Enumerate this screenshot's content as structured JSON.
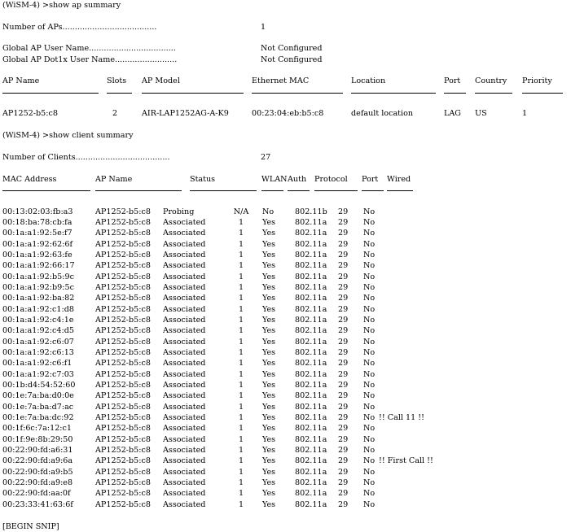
{
  "ap_cmd": {
    "prompt": "(WiSM-4) >show ap summary",
    "num_aps_label": "Number of APs......................................",
    "num_aps_value": "1",
    "user_name_label": "Global AP User Name...................................",
    "user_name_value": "Not Configured",
    "dot1x_label": "Global AP Dot1x User Name.........................",
    "dot1x_value": "Not Configured",
    "headers": [
      "AP Name",
      "Slots",
      "AP Model",
      "Ethernet MAC",
      "Location",
      "Port",
      "Country",
      "Priority"
    ],
    "row": [
      "AP1252-b5:c8",
      "2",
      "AIR-LAP1252AG-A-K9",
      "00:23:04:eb:b5:c8",
      "default location",
      "LAG",
      "US",
      "1"
    ]
  },
  "client_cmd": {
    "prompt": "(WiSM-4) >show client summary",
    "num_clients_label": "Number of Clients......................................",
    "num_clients_value": "27",
    "headers": [
      "MAC Address",
      "AP Name",
      "Status",
      "WLAN",
      "Auth",
      "Protocol",
      "Port",
      "Wired"
    ],
    "clients": [
      {
        "mac": "00:13:02:03:fb:a3",
        "ap": "AP1252-b5:c8",
        "status": "Probing",
        "wlan": "N/A",
        "auth": "No",
        "protocol": "802.11b",
        "port": "29",
        "wired": "No",
        "note": ""
      },
      {
        "mac": "00:18:ba:78:cb:fa",
        "ap": "AP1252-b5:c8",
        "status": "Associated",
        "wlan": "1",
        "auth": "Yes",
        "protocol": "802.11a",
        "port": "29",
        "wired": "No",
        "note": ""
      },
      {
        "mac": "00:1a:a1:92:5e:f7",
        "ap": "AP1252-b5:c8",
        "status": "Associated",
        "wlan": "1",
        "auth": "Yes",
        "protocol": "802.11a",
        "port": "29",
        "wired": "No",
        "note": ""
      },
      {
        "mac": "00:1a:a1:92:62:6f",
        "ap": "AP1252-b5:c8",
        "status": "Associated",
        "wlan": "1",
        "auth": "Yes",
        "protocol": "802.11a",
        "port": "29",
        "wired": "No",
        "note": ""
      },
      {
        "mac": "00:1a:a1:92:63:fe",
        "ap": "AP1252-b5:c8",
        "status": "Associated",
        "wlan": "1",
        "auth": "Yes",
        "protocol": "802.11a",
        "port": "29",
        "wired": "No",
        "note": ""
      },
      {
        "mac": "00:1a:a1:92:66:17",
        "ap": "AP1252-b5:c8",
        "status": "Associated",
        "wlan": "1",
        "auth": "Yes",
        "protocol": "802.11a",
        "port": "29",
        "wired": "No",
        "note": ""
      },
      {
        "mac": "00:1a:a1:92:b5:9c",
        "ap": "AP1252-b5:c8",
        "status": "Associated",
        "wlan": "1",
        "auth": "Yes",
        "protocol": "802.11a",
        "port": "29",
        "wired": "No",
        "note": ""
      },
      {
        "mac": "00:1a:a1:92:b9:5c",
        "ap": "AP1252-b5:c8",
        "status": "Associated",
        "wlan": "1",
        "auth": "Yes",
        "protocol": "802.11a",
        "port": "29",
        "wired": "No",
        "note": ""
      },
      {
        "mac": "00:1a:a1:92:ba:82",
        "ap": "AP1252-b5:c8",
        "status": "Associated",
        "wlan": "1",
        "auth": "Yes",
        "protocol": "802.11a",
        "port": "29",
        "wired": "No",
        "note": ""
      },
      {
        "mac": "00:1a:a1:92:c1:d8",
        "ap": "AP1252-b5:c8",
        "status": "Associated",
        "wlan": "1",
        "auth": "Yes",
        "protocol": "802.11a",
        "port": "29",
        "wired": "No",
        "note": ""
      },
      {
        "mac": "00:1a:a1:92:c4:1e",
        "ap": "AP1252-b5:c8",
        "status": "Associated",
        "wlan": "1",
        "auth": "Yes",
        "protocol": "802.11a",
        "port": "29",
        "wired": "No",
        "note": ""
      },
      {
        "mac": "00:1a:a1:92:c4:d5",
        "ap": "AP1252-b5:c8",
        "status": "Associated",
        "wlan": "1",
        "auth": "Yes",
        "protocol": "802.11a",
        "port": "29",
        "wired": "No",
        "note": ""
      },
      {
        "mac": "00:1a:a1:92:c6:07",
        "ap": "AP1252-b5:c8",
        "status": "Associated",
        "wlan": "1",
        "auth": "Yes",
        "protocol": "802.11a",
        "port": "29",
        "wired": "No",
        "note": ""
      },
      {
        "mac": "00:1a:a1:92:c6:13",
        "ap": "AP1252-b5:c8",
        "status": "Associated",
        "wlan": "1",
        "auth": "Yes",
        "protocol": "802.11a",
        "port": "29",
        "wired": "No",
        "note": ""
      },
      {
        "mac": "00:1a:a1:92:c6:f1",
        "ap": "AP1252-b5:c8",
        "status": "Associated",
        "wlan": "1",
        "auth": "Yes",
        "protocol": "802.11a",
        "port": "29",
        "wired": "No",
        "note": ""
      },
      {
        "mac": "00:1a:a1:92:c7:03",
        "ap": "AP1252-b5:c8",
        "status": "Associated",
        "wlan": "1",
        "auth": "Yes",
        "protocol": "802.11a",
        "port": "29",
        "wired": "No",
        "note": ""
      },
      {
        "mac": "00:1b:d4:54:52:60",
        "ap": "AP1252-b5:c8",
        "status": "Associated",
        "wlan": "1",
        "auth": "Yes",
        "protocol": "802.11a",
        "port": "29",
        "wired": "No",
        "note": ""
      },
      {
        "mac": "00:1e:7a:ba:d0:0e",
        "ap": "AP1252-b5:c8",
        "status": "Associated",
        "wlan": "1",
        "auth": "Yes",
        "protocol": "802.11a",
        "port": "29",
        "wired": "No",
        "note": ""
      },
      {
        "mac": "00:1e:7a:ba:d7:ac",
        "ap": "AP1252-b5:c8",
        "status": "Associated",
        "wlan": "1",
        "auth": "Yes",
        "protocol": "802.11a",
        "port": "29",
        "wired": "No",
        "note": ""
      },
      {
        "mac": "00:1e:7a:ba:dc:92",
        "ap": "AP1252-b5:c8",
        "status": "Associated",
        "wlan": "1",
        "auth": "Yes",
        "protocol": "802.11a",
        "port": "29",
        "wired": "No",
        "note": "!! Call 11 !!"
      },
      {
        "mac": "00:1f:6c:7a:12:c1",
        "ap": "AP1252-b5:c8",
        "status": "Associated",
        "wlan": "1",
        "auth": "Yes",
        "protocol": "802.11a",
        "port": "29",
        "wired": "No",
        "note": ""
      },
      {
        "mac": "00:1f:9e:8b:29:50",
        "ap": "AP1252-b5:c8",
        "status": "Associated",
        "wlan": "1",
        "auth": "Yes",
        "protocol": "802.11a",
        "port": "29",
        "wired": "No",
        "note": ""
      },
      {
        "mac": "00:22:90:fd:a6:31",
        "ap": "AP1252-b5:c8",
        "status": "Associated",
        "wlan": "1",
        "auth": "Yes",
        "protocol": "802.11a",
        "port": "29",
        "wired": "No",
        "note": ""
      },
      {
        "mac": "00:22:90:fd:a9:6a",
        "ap": "AP1252-b5:c8",
        "status": "Associated",
        "wlan": "1",
        "auth": "Yes",
        "protocol": "802.11a",
        "port": "29",
        "wired": "No",
        "note": "!! First Call !!"
      },
      {
        "mac": "00:22:90:fd:a9:b5",
        "ap": "AP1252-b5:c8",
        "status": "Associated",
        "wlan": "1",
        "auth": "Yes",
        "protocol": "802.11a",
        "port": "29",
        "wired": "No",
        "note": ""
      },
      {
        "mac": "00:22:90:fd:a9:e8",
        "ap": "AP1252-b5:c8",
        "status": "Associated",
        "wlan": "1",
        "auth": "Yes",
        "protocol": "802.11a",
        "port": "29",
        "wired": "No",
        "note": ""
      },
      {
        "mac": "00:22:90:fd:aa:0f",
        "ap": "AP1252-b5:c8",
        "status": "Associated",
        "wlan": "1",
        "auth": "Yes",
        "protocol": "802.11a",
        "port": "29",
        "wired": "No",
        "note": ""
      },
      {
        "mac": "00:23:33:41:63:6f",
        "ap": "AP1252-b5:c8",
        "status": "Associated",
        "wlan": "1",
        "auth": "Yes",
        "protocol": "802.11a",
        "port": "29",
        "wired": "No",
        "note": ""
      }
    ]
  },
  "footer": "[BEGIN SNIP]"
}
